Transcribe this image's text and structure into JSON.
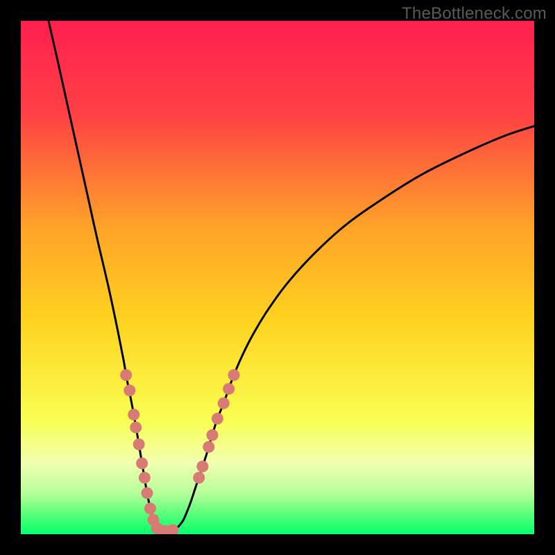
{
  "watermark": "TheBottleneck.com",
  "colors": {
    "frame": "#000000",
    "gradient_stops": [
      {
        "offset": 0.0,
        "color": "#ff1f4f"
      },
      {
        "offset": 0.18,
        "color": "#ff4044"
      },
      {
        "offset": 0.4,
        "color": "#ffa229"
      },
      {
        "offset": 0.58,
        "color": "#ffd21f"
      },
      {
        "offset": 0.78,
        "color": "#f9ff52"
      },
      {
        "offset": 0.86,
        "color": "#f2ffb0"
      },
      {
        "offset": 0.92,
        "color": "#b7ff9a"
      },
      {
        "offset": 0.96,
        "color": "#5aff7a"
      },
      {
        "offset": 1.0,
        "color": "#05ff6c"
      }
    ],
    "curve": "#000000",
    "marker": "#d87b74"
  },
  "chart_data": {
    "type": "line",
    "title": "",
    "xlabel": "",
    "ylabel": "",
    "xlim": [
      0,
      100
    ],
    "ylim": [
      0,
      100
    ],
    "minimum_x": 27,
    "series": [
      {
        "name": "bottleneck-curve",
        "points": [
          {
            "x": 5.4,
            "y": 100.0
          },
          {
            "x": 7.0,
            "y": 93.0
          },
          {
            "x": 9.0,
            "y": 84.0
          },
          {
            "x": 11.0,
            "y": 75.0
          },
          {
            "x": 13.0,
            "y": 66.0
          },
          {
            "x": 15.0,
            "y": 57.0
          },
          {
            "x": 17.0,
            "y": 48.5
          },
          {
            "x": 18.5,
            "y": 41.5
          },
          {
            "x": 20.0,
            "y": 34.0
          },
          {
            "x": 20.5,
            "y": 31.0
          },
          {
            "x": 21.0,
            "y": 28.5
          },
          {
            "x": 21.5,
            "y": 26.0
          },
          {
            "x": 22.0,
            "y": 23.3
          },
          {
            "x": 22.5,
            "y": 20.5
          },
          {
            "x": 23.0,
            "y": 17.5
          },
          {
            "x": 23.5,
            "y": 14.5
          },
          {
            "x": 24.0,
            "y": 11.5
          },
          {
            "x": 24.5,
            "y": 8.5
          },
          {
            "x": 25.0,
            "y": 6.0
          },
          {
            "x": 25.5,
            "y": 4.0
          },
          {
            "x": 26.0,
            "y": 2.3
          },
          {
            "x": 26.5,
            "y": 1.2
          },
          {
            "x": 27.0,
            "y": 0.7
          },
          {
            "x": 27.5,
            "y": 0.6
          },
          {
            "x": 28.5,
            "y": 0.6
          },
          {
            "x": 29.5,
            "y": 0.7
          },
          {
            "x": 30.5,
            "y": 1.3
          },
          {
            "x": 31.5,
            "y": 2.5
          },
          {
            "x": 32.0,
            "y": 3.5
          },
          {
            "x": 33.0,
            "y": 6.0
          },
          {
            "x": 34.0,
            "y": 9.0
          },
          {
            "x": 35.0,
            "y": 12.0
          },
          {
            "x": 36.0,
            "y": 15.0
          },
          {
            "x": 36.6,
            "y": 17.0
          },
          {
            "x": 37.5,
            "y": 20.0
          },
          {
            "x": 38.3,
            "y": 22.5
          },
          {
            "x": 39.5,
            "y": 25.5
          },
          {
            "x": 40.5,
            "y": 28.3
          },
          {
            "x": 41.5,
            "y": 31.0
          },
          {
            "x": 43.0,
            "y": 34.5
          },
          {
            "x": 45.0,
            "y": 38.5
          },
          {
            "x": 48.0,
            "y": 43.5
          },
          {
            "x": 52.0,
            "y": 49.0
          },
          {
            "x": 57.0,
            "y": 54.5
          },
          {
            "x": 63.0,
            "y": 60.0
          },
          {
            "x": 70.0,
            "y": 65.0
          },
          {
            "x": 78.0,
            "y": 70.0
          },
          {
            "x": 86.0,
            "y": 74.0
          },
          {
            "x": 94.0,
            "y": 77.5
          },
          {
            "x": 100.0,
            "y": 79.5
          }
        ]
      }
    ],
    "markers": [
      {
        "x": 20.5,
        "y": 31.0
      },
      {
        "x": 21.2,
        "y": 28.0
      },
      {
        "x": 22.0,
        "y": 23.3
      },
      {
        "x": 22.4,
        "y": 20.8
      },
      {
        "x": 23.0,
        "y": 17.5
      },
      {
        "x": 23.6,
        "y": 13.8
      },
      {
        "x": 24.1,
        "y": 11.0
      },
      {
        "x": 24.6,
        "y": 8.0
      },
      {
        "x": 25.2,
        "y": 5.0
      },
      {
        "x": 25.8,
        "y": 2.8
      },
      {
        "x": 26.5,
        "y": 1.2
      },
      {
        "x": 27.3,
        "y": 0.7
      },
      {
        "x": 28.1,
        "y": 0.6
      },
      {
        "x": 28.9,
        "y": 0.6
      },
      {
        "x": 29.6,
        "y": 0.8
      },
      {
        "x": 34.7,
        "y": 11.0
      },
      {
        "x": 35.4,
        "y": 13.2
      },
      {
        "x": 36.6,
        "y": 17.0
      },
      {
        "x": 37.3,
        "y": 19.3
      },
      {
        "x": 38.3,
        "y": 22.5
      },
      {
        "x": 39.5,
        "y": 25.5
      },
      {
        "x": 40.5,
        "y": 28.3
      },
      {
        "x": 41.5,
        "y": 31.0
      }
    ]
  }
}
